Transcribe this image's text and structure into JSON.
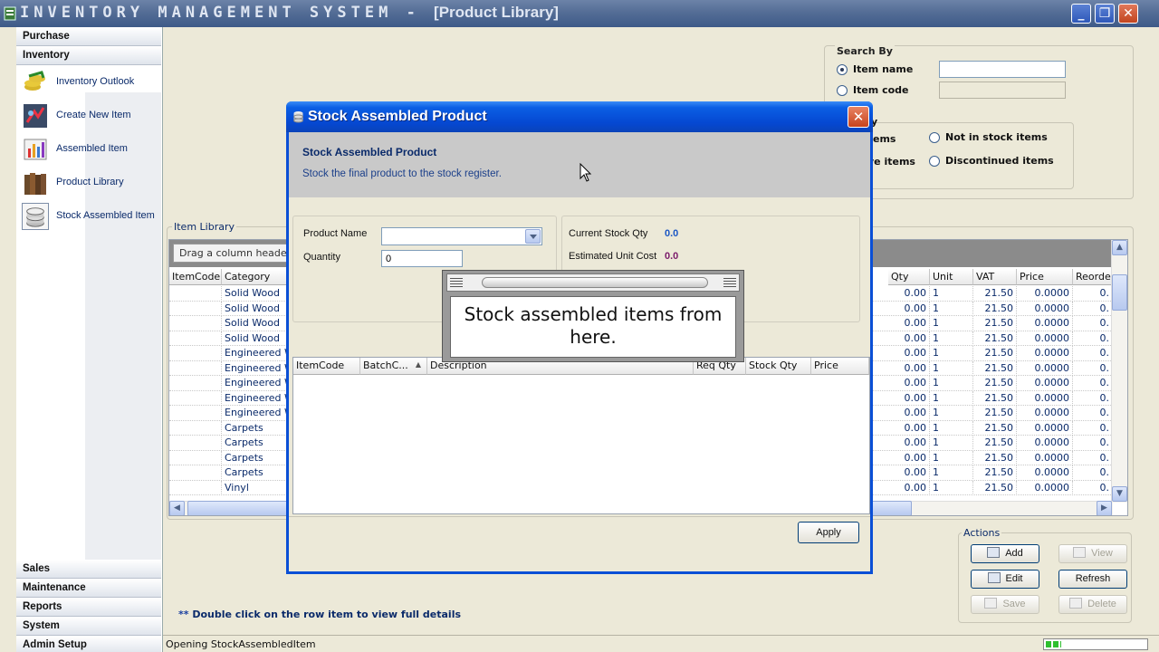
{
  "window": {
    "title": "INVENTORY MANAGEMENT SYSTEM - ",
    "subtitle": "[Product Library]",
    "icons": {
      "minimize": "minimize-icon",
      "restore": "restore-icon",
      "close": "close-icon"
    }
  },
  "nav": {
    "sections_top": [
      "Purchase",
      "Inventory"
    ],
    "items": [
      {
        "label": "Inventory Outlook",
        "icon": "inventory-outlook-icon"
      },
      {
        "label": "Create New Item",
        "icon": "create-new-item-icon"
      },
      {
        "label": "Assembled Item",
        "icon": "assembled-item-icon"
      },
      {
        "label": "Product Library",
        "icon": "product-library-icon"
      },
      {
        "label": "Stock Assembled Item",
        "icon": "stock-assembled-item-icon"
      }
    ],
    "sections_bottom": [
      "Sales",
      "Maintenance",
      "Reports",
      "System",
      "Admin Setup"
    ]
  },
  "search": {
    "legend": "Search By",
    "option_name": "Item name",
    "option_code": "Item code",
    "selected": "Item name"
  },
  "filter": {
    "legend_partial": "y",
    "opt1_partial": "ems",
    "opt2_partial": "ve items",
    "opt3": "Not in stock items",
    "opt4": "Discontinued items"
  },
  "library": {
    "legend": "Item Library",
    "group_hint": "Drag a column header he",
    "left_headers": [
      "ItemCode",
      "Category"
    ],
    "right_headers": [
      "Qty",
      "Unit",
      "VAT",
      "Price",
      "Reorder."
    ],
    "categories": [
      "Solid Wood",
      "Solid Wood",
      "Solid Wood",
      "Solid Wood",
      "Engineered Wo",
      "Engineered Wo",
      "Engineered Wo",
      "Engineered Wo",
      "Engineered Wo",
      "Carpets",
      "Carpets",
      "Carpets",
      "Carpets",
      "Vinyl"
    ],
    "qty": "0.00",
    "unit": "1",
    "vat": "21.50",
    "price": "0.0000",
    "reorder": "0."
  },
  "hint": {
    "stars": "**",
    "text": " Double click on the row item to view full details"
  },
  "actions": {
    "legend": "Actions",
    "add": "Add",
    "view": "View",
    "edit": "Edit",
    "refresh": "Refresh",
    "save": "Save",
    "delete": "Delete"
  },
  "status": {
    "text": "Opening StockAssembledItem",
    "progress": 0.15
  },
  "dialog": {
    "title": "Stock Assembled Product",
    "banner_title": "Stock Assembled Product",
    "banner_sub": "Stock the final product to the stock register.",
    "product_name_label": "Product Name",
    "quantity_label": "Quantity",
    "quantity_value": "0",
    "current_stock_label": "Current Stock Qty",
    "current_stock_value": "0.0",
    "est_cost_label": "Estimated Unit Cost",
    "est_cost_value": "0.0",
    "grid_headers": [
      "ItemCode",
      "BatchC...",
      "Description",
      "Req Qty",
      "Stock Qty",
      "Price"
    ],
    "apply": "Apply",
    "colors": {
      "stock_value": "#1a56c4",
      "cost_value": "#7a1a6a"
    }
  },
  "callout": {
    "text": "Stock assembled items from here."
  }
}
